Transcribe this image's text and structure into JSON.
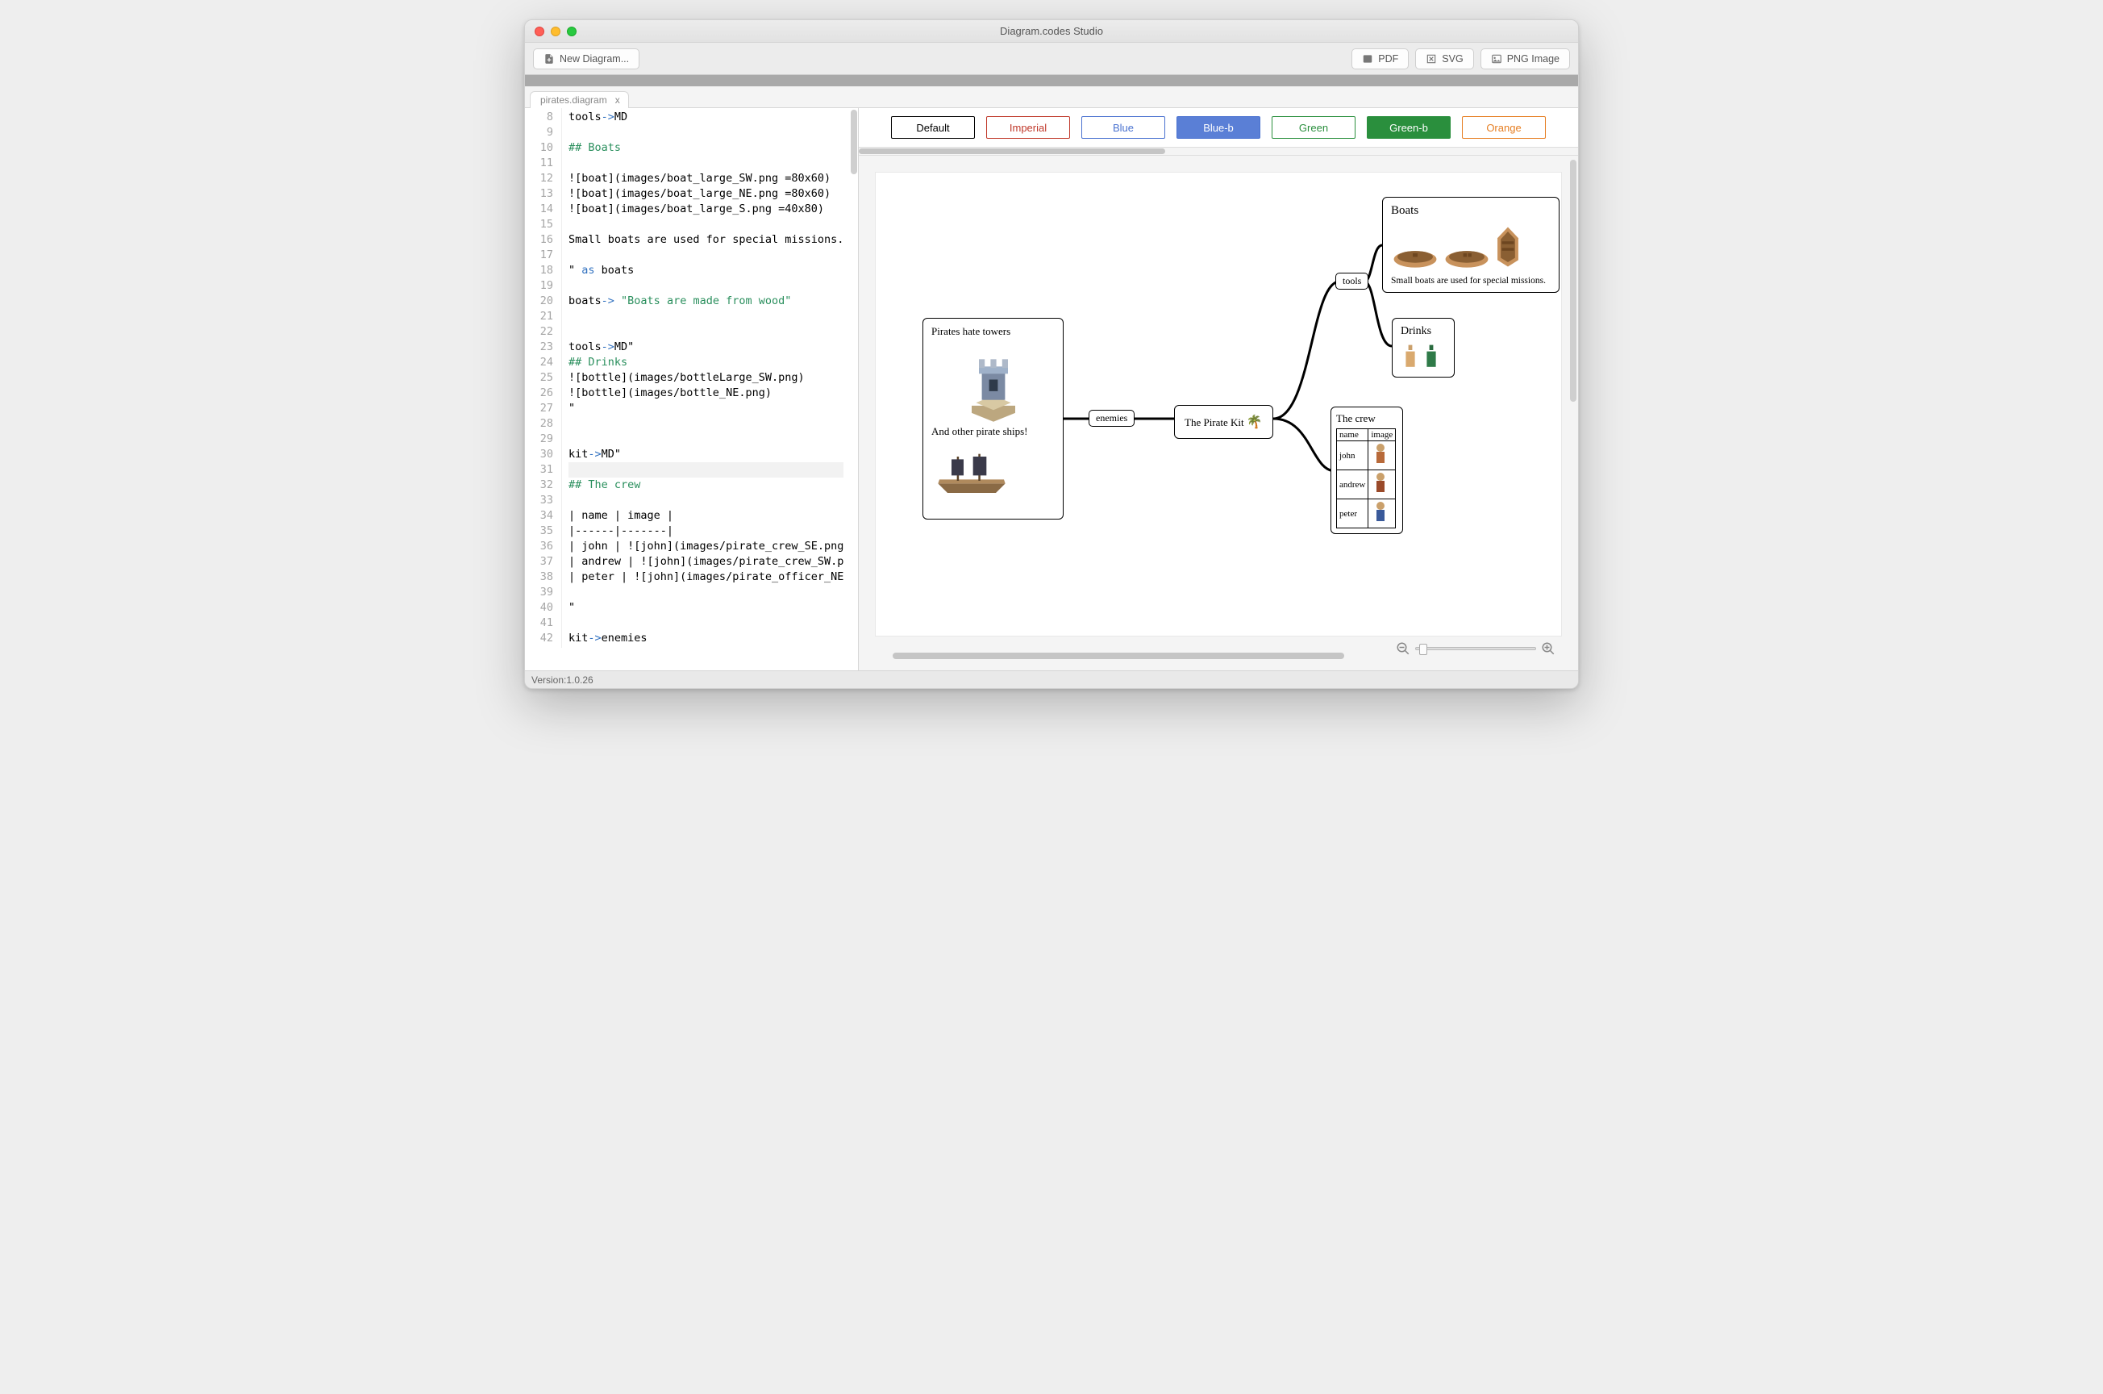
{
  "window": {
    "title": "Diagram.codes Studio"
  },
  "toolbar": {
    "new_diagram": "New Diagram...",
    "export": {
      "pdf": "PDF",
      "svg": "SVG",
      "png": "PNG Image"
    }
  },
  "tabs": [
    {
      "label": "pirates.diagram",
      "close": "x"
    }
  ],
  "editor": {
    "first_line_number": 8,
    "active_line": 31,
    "lines": [
      {
        "raw": "tools->MD",
        "spans": [
          [
            "",
            "tools"
          ],
          [
            "op",
            "->"
          ],
          [
            "",
            "MD"
          ]
        ]
      },
      {
        "raw": "",
        "spans": []
      },
      {
        "raw": "## Boats",
        "spans": [
          [
            "head",
            "## Boats"
          ]
        ]
      },
      {
        "raw": "",
        "spans": []
      },
      {
        "raw": "![boat](images/boat_large_SW.png =80x60)",
        "spans": [
          [
            "",
            "![boat](images/boat_large_SW.png =80x60)"
          ]
        ]
      },
      {
        "raw": "![boat](images/boat_large_NE.png =80x60)",
        "spans": [
          [
            "",
            "![boat](images/boat_large_NE.png =80x60)"
          ]
        ]
      },
      {
        "raw": "![boat](images/boat_large_S.png =40x80)",
        "spans": [
          [
            "",
            "![boat](images/boat_large_S.png =40x80)"
          ]
        ]
      },
      {
        "raw": "",
        "spans": []
      },
      {
        "raw": "Small boats are used for special missions.",
        "spans": [
          [
            "",
            "Small boats are used for special missions."
          ]
        ]
      },
      {
        "raw": "",
        "spans": []
      },
      {
        "raw": "\" as boats",
        "spans": [
          [
            "",
            "\" "
          ],
          [
            "kw",
            "as"
          ],
          [
            "",
            " boats"
          ]
        ]
      },
      {
        "raw": "",
        "spans": []
      },
      {
        "raw": "boats-> \"Boats are made from wood\"",
        "spans": [
          [
            "",
            "boats"
          ],
          [
            "op",
            "->"
          ],
          [
            "",
            " "
          ],
          [
            "str",
            "\"Boats are made from wood\""
          ]
        ]
      },
      {
        "raw": "",
        "spans": []
      },
      {
        "raw": "",
        "spans": []
      },
      {
        "raw": "tools->MD\"",
        "spans": [
          [
            "",
            "tools"
          ],
          [
            "op",
            "->"
          ],
          [
            "",
            "MD\""
          ]
        ]
      },
      {
        "raw": "## Drinks",
        "spans": [
          [
            "head",
            "## Drinks"
          ]
        ]
      },
      {
        "raw": "![bottle](images/bottleLarge_SW.png)",
        "spans": [
          [
            "",
            "![bottle](images/bottleLarge_SW.png)"
          ]
        ]
      },
      {
        "raw": "![bottle](images/bottle_NE.png)",
        "spans": [
          [
            "",
            "![bottle](images/bottle_NE.png)"
          ]
        ]
      },
      {
        "raw": "\"",
        "spans": [
          [
            "",
            "\""
          ]
        ]
      },
      {
        "raw": "",
        "spans": []
      },
      {
        "raw": "",
        "spans": []
      },
      {
        "raw": "kit->MD\"",
        "spans": [
          [
            "",
            "kit"
          ],
          [
            "op",
            "->"
          ],
          [
            "",
            "MD\""
          ]
        ]
      },
      {
        "raw": "",
        "spans": []
      },
      {
        "raw": "## The crew",
        "spans": [
          [
            "head",
            "## The crew"
          ]
        ]
      },
      {
        "raw": "",
        "spans": []
      },
      {
        "raw": "| name | image |",
        "spans": [
          [
            "",
            "| name | image |"
          ]
        ]
      },
      {
        "raw": "|------|-------|",
        "spans": [
          [
            "",
            "|------|-------|"
          ]
        ]
      },
      {
        "raw": "| john | ![john](images/pirate_crew_SE.png",
        "spans": [
          [
            "",
            "| john | ![john](images/pirate_crew_SE.png"
          ]
        ]
      },
      {
        "raw": "| andrew | ![john](images/pirate_crew_SW.p",
        "spans": [
          [
            "",
            "| andrew | ![john](images/pirate_crew_SW.p"
          ]
        ]
      },
      {
        "raw": "| peter | ![john](images/pirate_officer_NE",
        "spans": [
          [
            "",
            "| peter | ![john](images/pirate_officer_NE"
          ]
        ]
      },
      {
        "raw": "",
        "spans": []
      },
      {
        "raw": "\"",
        "spans": [
          [
            "",
            "\""
          ]
        ]
      },
      {
        "raw": "",
        "spans": []
      },
      {
        "raw": "kit->enemies",
        "spans": [
          [
            "",
            "kit"
          ],
          [
            "op",
            "->"
          ],
          [
            "",
            "enemies"
          ]
        ]
      }
    ]
  },
  "themes": [
    {
      "label": "Default",
      "class": "theme-default"
    },
    {
      "label": "Imperial",
      "class": "theme-imperial"
    },
    {
      "label": "Blue",
      "class": "theme-blue"
    },
    {
      "label": "Blue-b",
      "class": "theme-blue-b"
    },
    {
      "label": "Green",
      "class": "theme-green"
    },
    {
      "label": "Green-b",
      "class": "theme-green-b"
    },
    {
      "label": "Orange",
      "class": "theme-orange"
    }
  ],
  "diagram": {
    "center_label": "The Pirate Kit",
    "edge_enemies": "enemies",
    "edge_tools": "tools",
    "enemies": {
      "line1": "Pirates hate towers",
      "line2": "And other pirate ships!"
    },
    "boats": {
      "title": "Boats",
      "caption": "Small boats are used for special missions."
    },
    "drinks": {
      "title": "Drinks"
    },
    "crew": {
      "title": "The crew",
      "headers": [
        "name",
        "image"
      ],
      "rows": [
        "john",
        "andrew",
        "peter"
      ]
    }
  },
  "status": {
    "version": "Version:1.0.26"
  }
}
